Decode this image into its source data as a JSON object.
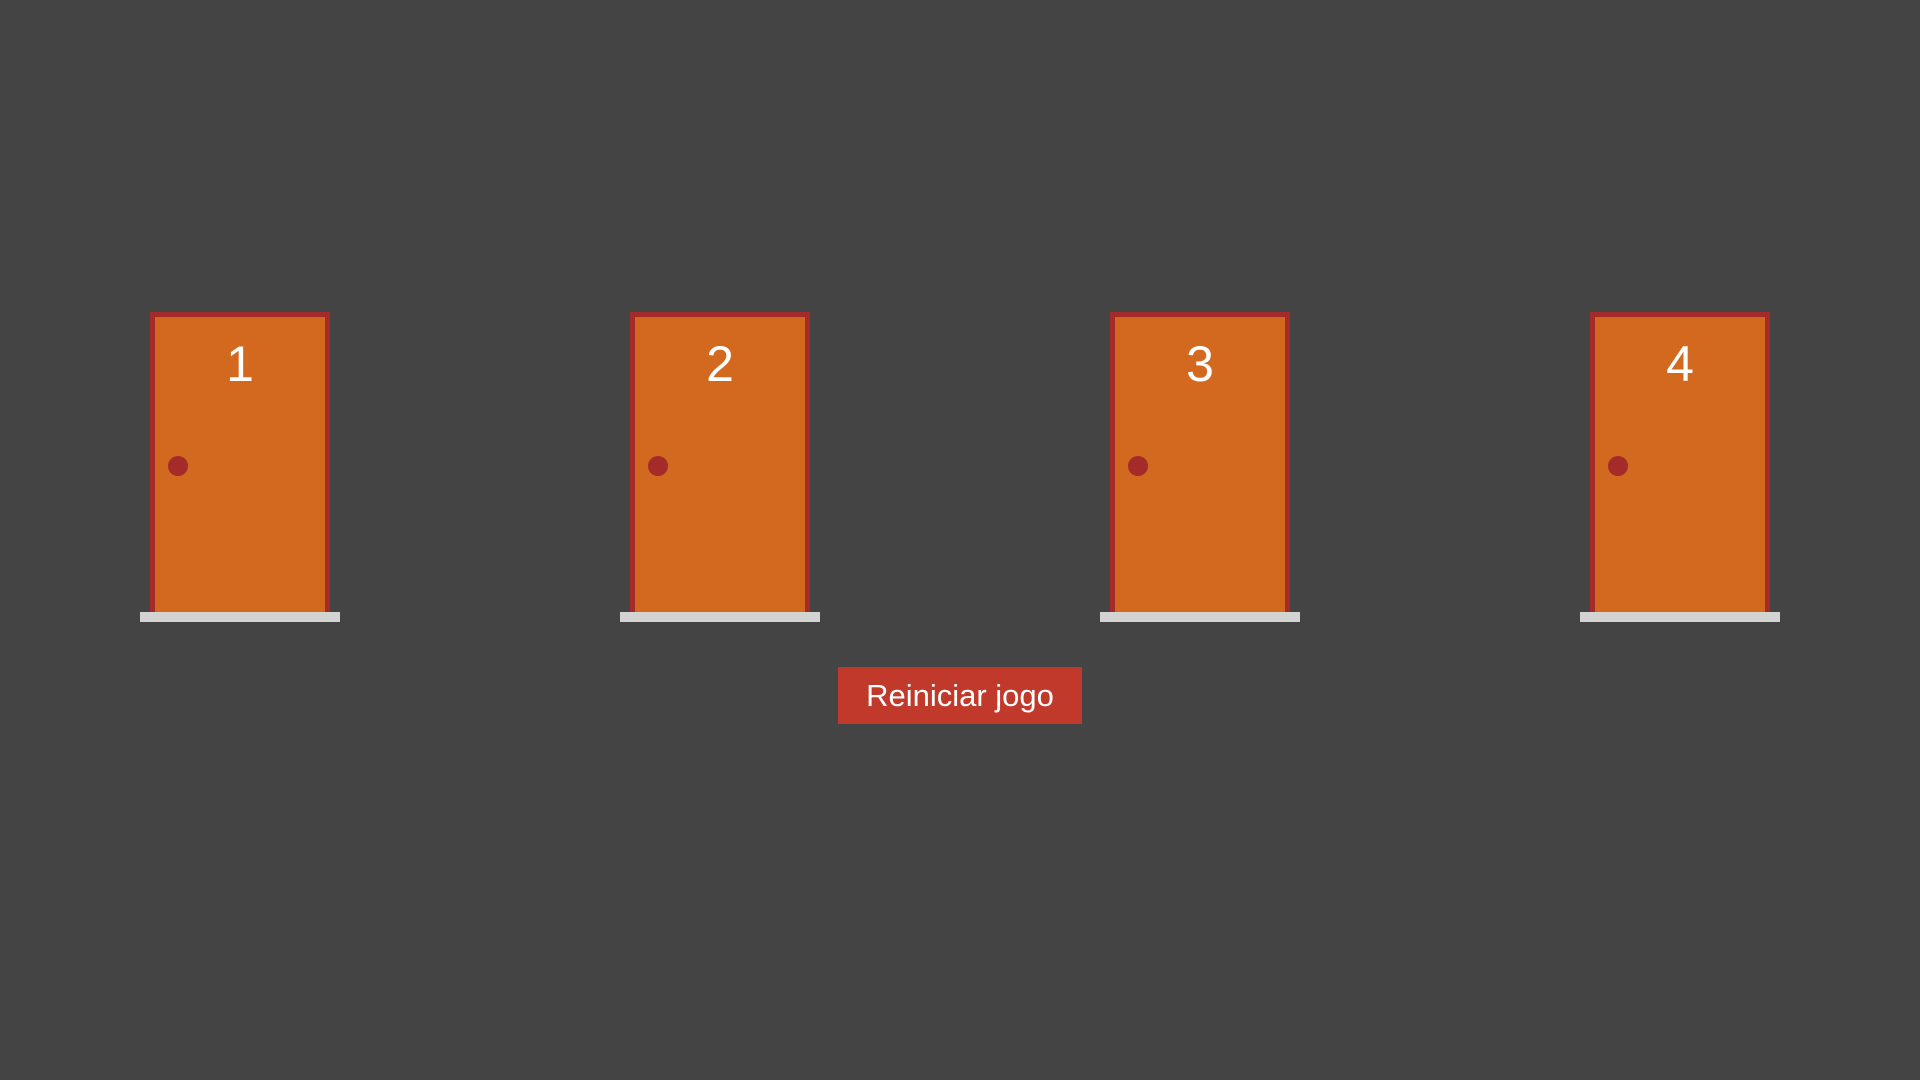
{
  "game": {
    "doors": [
      {
        "number": "1"
      },
      {
        "number": "2"
      },
      {
        "number": "3"
      },
      {
        "number": "4"
      }
    ],
    "restart_label": "Reiniciar jogo"
  },
  "colors": {
    "background": "#444444",
    "door_fill": "#D2691E",
    "door_frame": "#A52A2A",
    "door_knob": "#A52A2A",
    "threshold": "#D3D3D3",
    "restart_button": "#C0392B"
  }
}
